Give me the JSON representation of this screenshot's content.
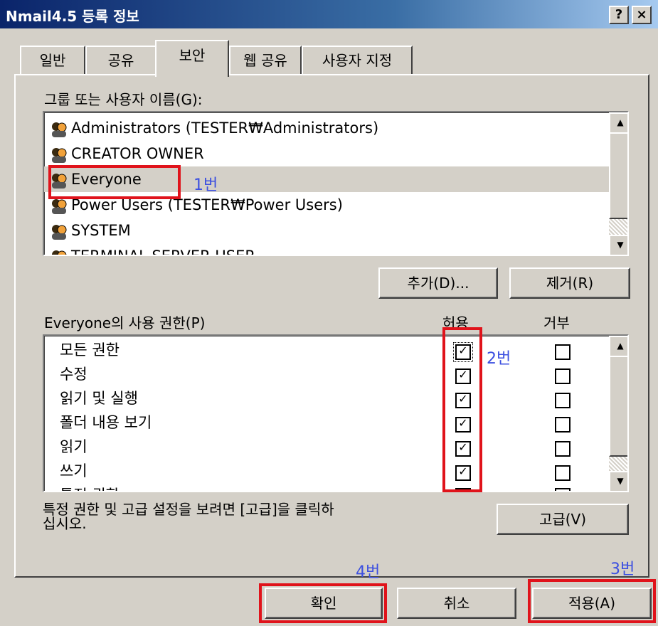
{
  "window": {
    "title": "Nmail4.5 등록 정보",
    "help_btn": "?",
    "close_btn": "×"
  },
  "tabs": [
    "일반",
    "공유",
    "보안",
    "웹 공유",
    "사용자 지정"
  ],
  "groups": {
    "label": "그룹 또는 사용자 이름(G):",
    "items": [
      "Administrators (TESTER₩Administrators)",
      "CREATOR OWNER",
      "Everyone",
      "Power Users (TESTER₩Power Users)",
      "SYSTEM",
      "TERMINAL SERVER USER"
    ],
    "selected": "Everyone"
  },
  "buttons": {
    "add": "추가(D)...",
    "remove": "제거(R)",
    "advanced": "고급(V)",
    "ok": "확인",
    "cancel": "취소",
    "apply": "적용(A)"
  },
  "permissions": {
    "label": "Everyone의 사용 권한(P)",
    "allow_header": "허용",
    "deny_header": "거부",
    "rows": [
      "모든 권한",
      "수정",
      "읽기 및 실행",
      "폴더 내용 보기",
      "읽기",
      "쓰기",
      "특정 권한"
    ],
    "allow_mark": "✓"
  },
  "advanced_text": {
    "line1": "특정 권한 및 고급 설정을 보려면 [고급]을 클릭하",
    "line2": "십시오."
  },
  "annotations": {
    "a1": "1번",
    "a2": "2번",
    "a3": "3번",
    "a4": "4번",
    "color": "#e0131b"
  }
}
